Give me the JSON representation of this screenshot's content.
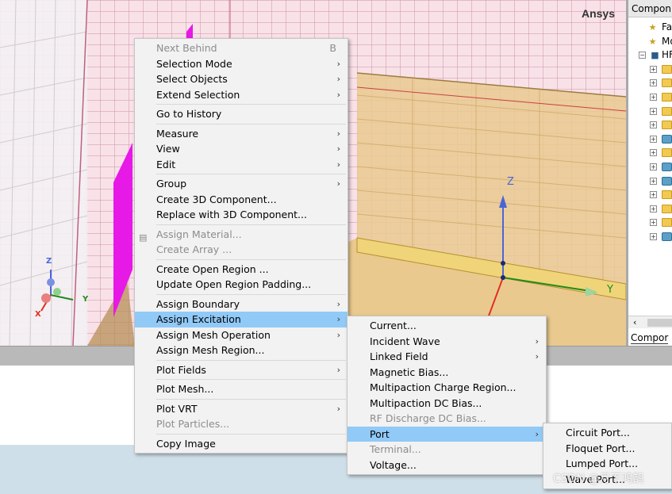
{
  "viewport": {
    "brand": "Ansys",
    "axes": {
      "x": "X",
      "y": "Y",
      "z": "Z"
    },
    "triad": {
      "x": "X",
      "y": "Y",
      "z": "Z"
    }
  },
  "side_panel": {
    "title": "Compon...",
    "items": [
      {
        "label": "Fav",
        "icon": "favorite-icon"
      },
      {
        "label": "Mo",
        "icon": "model-icon"
      },
      {
        "label": "HF",
        "icon": "hfss-icon"
      }
    ],
    "folder_count": 13,
    "tab_label": "Compor"
  },
  "context_menu": {
    "items": [
      {
        "label": "Next Behind",
        "shortcut": "B",
        "disabled": true
      },
      {
        "label": "Selection Mode",
        "submenu": true
      },
      {
        "label": "Select Objects",
        "submenu": true
      },
      {
        "label": "Extend Selection",
        "submenu": true
      },
      {
        "label": "Go to History"
      },
      {
        "label": "Measure",
        "submenu": true
      },
      {
        "label": "View",
        "submenu": true
      },
      {
        "label": "Edit",
        "submenu": true
      },
      {
        "label": "Group",
        "submenu": true
      },
      {
        "label": "Create 3D Component..."
      },
      {
        "label": "Replace with 3D Component..."
      },
      {
        "label": "Assign Material...",
        "disabled": true
      },
      {
        "label": "Create Array ...",
        "disabled": true
      },
      {
        "label": "Create Open Region ..."
      },
      {
        "label": "Update Open Region Padding..."
      },
      {
        "label": "Assign Boundary",
        "submenu": true
      },
      {
        "label": "Assign Excitation",
        "submenu": true,
        "active": true
      },
      {
        "label": "Assign Mesh Operation",
        "submenu": true
      },
      {
        "label": "Assign Mesh Region..."
      },
      {
        "label": "Plot Fields",
        "submenu": true
      },
      {
        "label": "Plot Mesh..."
      },
      {
        "label": "Plot VRT",
        "submenu": true
      },
      {
        "label": "Plot Particles...",
        "disabled": true
      },
      {
        "label": "Copy Image"
      }
    ]
  },
  "excitation_menu": {
    "items": [
      {
        "label": "Current..."
      },
      {
        "label": "Incident Wave",
        "submenu": true
      },
      {
        "label": "Linked Field",
        "submenu": true
      },
      {
        "label": "Magnetic Bias..."
      },
      {
        "label": "Multipaction Charge Region..."
      },
      {
        "label": "Multipaction DC Bias..."
      },
      {
        "label": "RF Discharge DC Bias...",
        "disabled": true
      },
      {
        "label": "Port",
        "submenu": true,
        "active": true
      },
      {
        "label": "Terminal...",
        "disabled": true
      },
      {
        "label": "Voltage..."
      }
    ]
  },
  "port_menu": {
    "items": [
      {
        "label": "Circuit Port..."
      },
      {
        "label": "Floquet Port..."
      },
      {
        "label": "Lumped Port..."
      },
      {
        "label": "Wave Port..."
      }
    ]
  },
  "watermark": "CSDN @月下鸿鹄",
  "colors": {
    "menu_highlight": "#91c9f7",
    "viewport_bg": "#f8e2e8",
    "substrate": "#eac98f",
    "magenta_face": "#e619e6",
    "axis_z": "#4a66d6",
    "axis_y": "#1f8a1f",
    "axis_x": "#e03020"
  }
}
